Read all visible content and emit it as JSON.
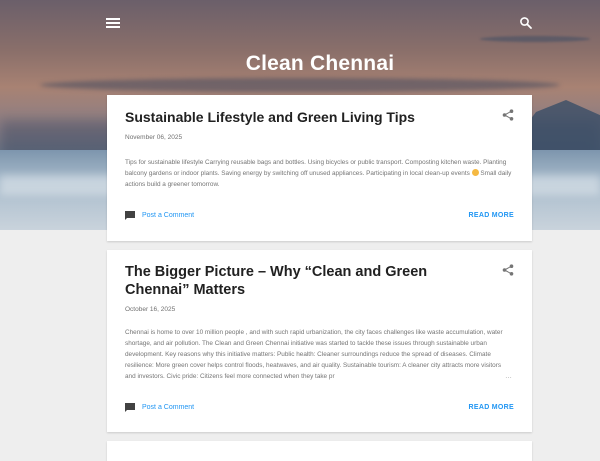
{
  "blog": {
    "title": "Clean Chennai"
  },
  "header": {
    "menu_icon": "hamburger-menu-icon",
    "search_icon": "search-icon"
  },
  "posts": [
    {
      "title": "Sustainable Lifestyle and Green Living Tips",
      "date": "November 06, 2025",
      "snippet_before_emoji": "Tips for sustainable lifestyle Carrying reusable bags and bottles. Using bicycles or public transport. Composting kitchen waste. Planting balcony gardens or indoor plants. Saving energy by switching off unused appliances. Participating in local clean-up events",
      "emoji": "smiling-face-emoji",
      "snippet_after_emoji": "Small daily actions build a greener tomorrow.",
      "comment_label": "Post a Comment",
      "read_more_label": "READ MORE"
    },
    {
      "title": "The Bigger Picture – Why “Clean and Green Chennai” Matters",
      "date": "October 16, 2025",
      "snippet": "Chennai is home to over 10 million people , and with such rapid urbanization, the city faces challenges like waste accumulation, water shortage, and air pollution. The Clean and Green Chennai initiative was started to tackle these issues through sustainable urban development.  Key reasons why this initiative matters: Public health: Cleaner surroundings reduce the spread of diseases. Climate resilience: More green cover helps control floods, heatwaves, and air quality. Sustainable tourism: A cleaner city attracts more visitors and investors. Civic pride: Citizens feel more connected when they take pr",
      "ellipsis": "…",
      "comment_label": "Post a Comment",
      "read_more_label": "READ MORE"
    }
  ],
  "colors": {
    "accent": "#2196f3",
    "title": "#212121",
    "background": "#eeeeee"
  }
}
